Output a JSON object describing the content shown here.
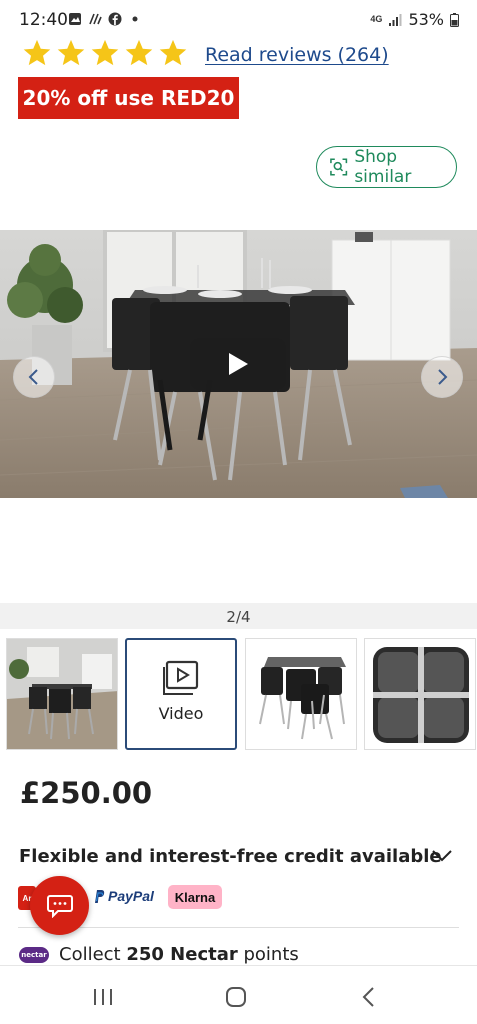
{
  "status_bar": {
    "time": "12:40",
    "network": "4G",
    "battery": "53%"
  },
  "rating": {
    "stars": 5,
    "star_color": "#f5c518",
    "reviews_link": "Read reviews (264)"
  },
  "promo": {
    "text": "20% off use RED20",
    "color": "#d42114"
  },
  "shop_similar": {
    "label": "Shop similar",
    "color": "#1f8a5c"
  },
  "gallery": {
    "counter": "2/4",
    "thumbnails": [
      {
        "kind": "photo"
      },
      {
        "kind": "video",
        "label": "Video"
      },
      {
        "kind": "photo"
      },
      {
        "kind": "photo"
      }
    ]
  },
  "price": "£250.00",
  "credit": {
    "title": "Flexible and interest-free credit available",
    "argos_pay": "Ar",
    "paypal": "PayPal",
    "klarna": "Klarna"
  },
  "nectar": {
    "logo": "nectar",
    "text_pre": "Collect ",
    "points": "250 Nectar",
    "text_post": " points"
  }
}
